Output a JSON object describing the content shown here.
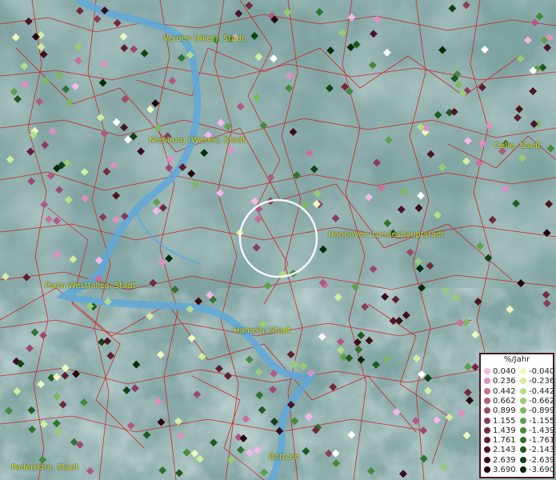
{
  "cities": [
    {
      "id": "verden",
      "label": "Verden (Aller), Stadt"
    },
    {
      "id": "nienburg",
      "label": "Nienburg (Weser), Stadt"
    },
    {
      "id": "celle",
      "label": "Celle, Stadt"
    },
    {
      "id": "hannover",
      "label": "Hannover, Landeshauptstadt"
    },
    {
      "id": "porta",
      "label": "Porta Westfalica, Stadt"
    },
    {
      "id": "hameln",
      "label": "Hameln, Stadt"
    },
    {
      "id": "paderborn",
      "label": "Paderborn, Stadt"
    },
    {
      "id": "bottzen",
      "label": "Bottzen"
    }
  ],
  "legend": {
    "title": "%/Jahr",
    "positive": [
      {
        "value": "0.040",
        "color": "#f4b8e8"
      },
      {
        "value": "0.236",
        "color": "#e090c0"
      },
      {
        "value": "0.442",
        "color": "#c87098"
      },
      {
        "value": "0.662",
        "color": "#b05a80"
      },
      {
        "value": "0.899",
        "color": "#9c4a6c"
      },
      {
        "value": "1.155",
        "color": "#8a3c5c"
      },
      {
        "value": "1.439",
        "color": "#74283e"
      },
      {
        "value": "1.761",
        "color": "#601e30"
      },
      {
        "value": "2.143",
        "color": "#4c1426"
      },
      {
        "value": "2.639",
        "color": "#3a0c1c"
      },
      {
        "value": "3.690",
        "color": "#240610"
      }
    ],
    "negative": [
      {
        "value": "-0.040",
        "color": "#eef8c0"
      },
      {
        "value": "-0.236",
        "color": "#d4eea0"
      },
      {
        "value": "-0.442",
        "color": "#b4de88"
      },
      {
        "value": "-0.662",
        "color": "#98cc74"
      },
      {
        "value": "-0.899",
        "color": "#7cb860"
      },
      {
        "value": "-1.155",
        "color": "#5ea04c"
      },
      {
        "value": "-1.439",
        "color": "#468a3c"
      },
      {
        "value": "-1.761",
        "color": "#32722e"
      },
      {
        "value": "-2.143",
        "color": "#205a20"
      },
      {
        "value": "-2.639",
        "color": "#124216"
      },
      {
        "value": "-3.690",
        "color": "#062a0c"
      }
    ]
  },
  "colors": {
    "river": "#5fa8d8",
    "borders": "#d01818",
    "terrain": "#7fa3a1",
    "marker_ring": "#ffffff"
  }
}
